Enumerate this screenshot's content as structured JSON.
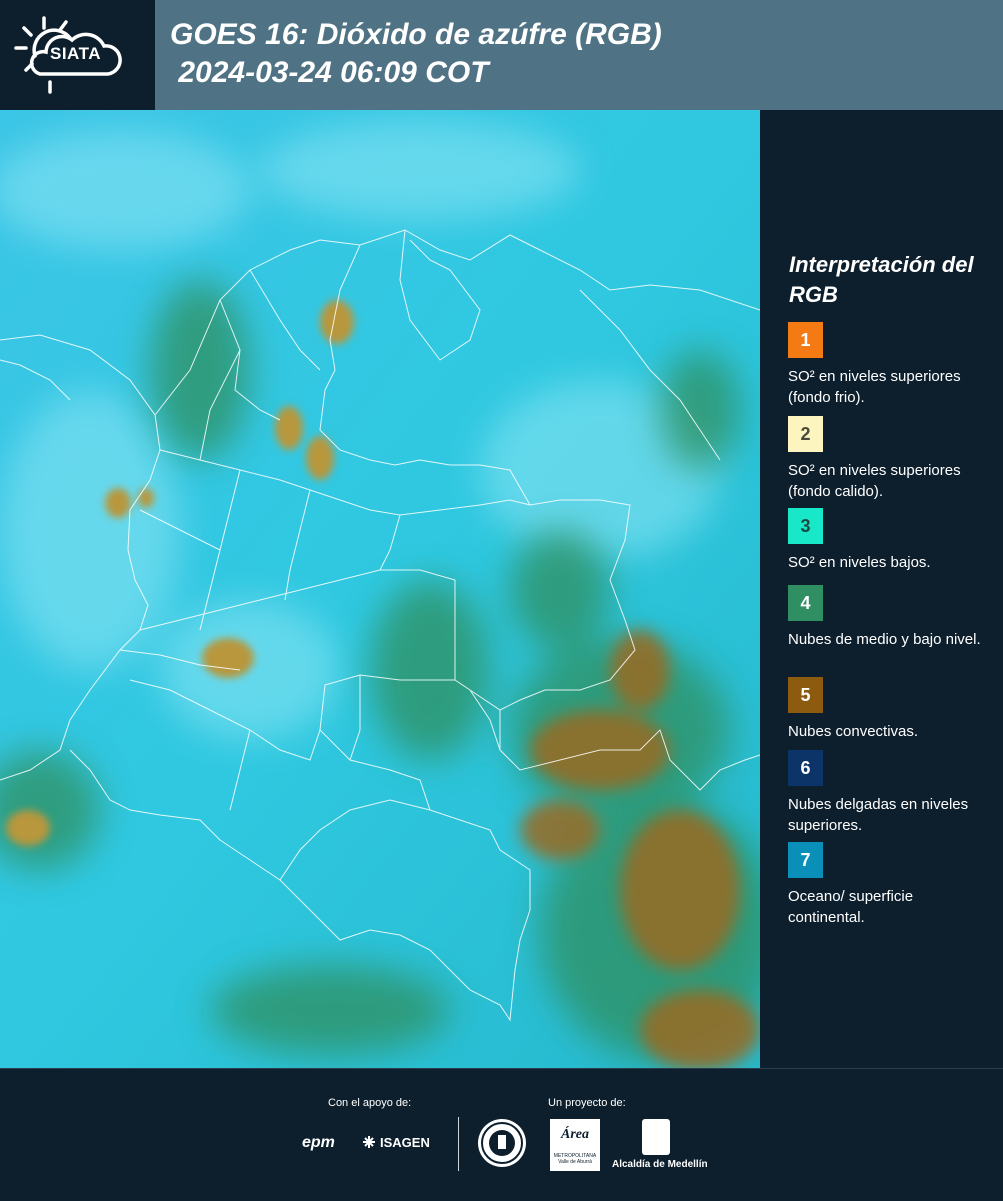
{
  "header": {
    "logo_text": "SIATA",
    "title_line1": "GOES 16: Dióxido de azúfre (RGB)",
    "title_line2": " 2024-03-24 06:09 COT"
  },
  "legend": {
    "title": "Interpretación del RGB",
    "items": [
      {
        "number": "1",
        "color": "#f47b14",
        "text_color": "#ffffff",
        "label": "SO² en niveles superiores (fondo frio)."
      },
      {
        "number": "2",
        "color": "#fdf5c0",
        "text_color": "#4a4a3a",
        "label": "SO² en niveles superiores (fondo calido)."
      },
      {
        "number": "3",
        "color": "#19e8c8",
        "text_color": "#1a4a44",
        "label": "SO² en niveles bajos."
      },
      {
        "number": "4",
        "color": "#2f8f63",
        "text_color": "#ffffff",
        "label": "Nubes de medio y bajo nivel."
      },
      {
        "number": "5",
        "color": "#8d5b10",
        "text_color": "#ffffff",
        "label": "Nubes convectivas."
      },
      {
        "number": "6",
        "color": "#0c3468",
        "text_color": "#ffffff",
        "label": "Nubes delgadas en niveles superiores."
      },
      {
        "number": "7",
        "color": "#0a8fb8",
        "text_color": "#ffffff",
        "label": "Oceano/ superficie continental."
      }
    ]
  },
  "footer": {
    "support_label": "Con el apoyo de:",
    "project_label": "Un proyecto de:",
    "sponsor1": "epm",
    "sponsor2": "ISAGEN",
    "partner_area_name": "Área",
    "partner_area_sub": "METROPOLITANA",
    "partner_area_sub2": "Valle de Aburrá",
    "partner_alcaldia": "Alcaldía de Medellín"
  }
}
